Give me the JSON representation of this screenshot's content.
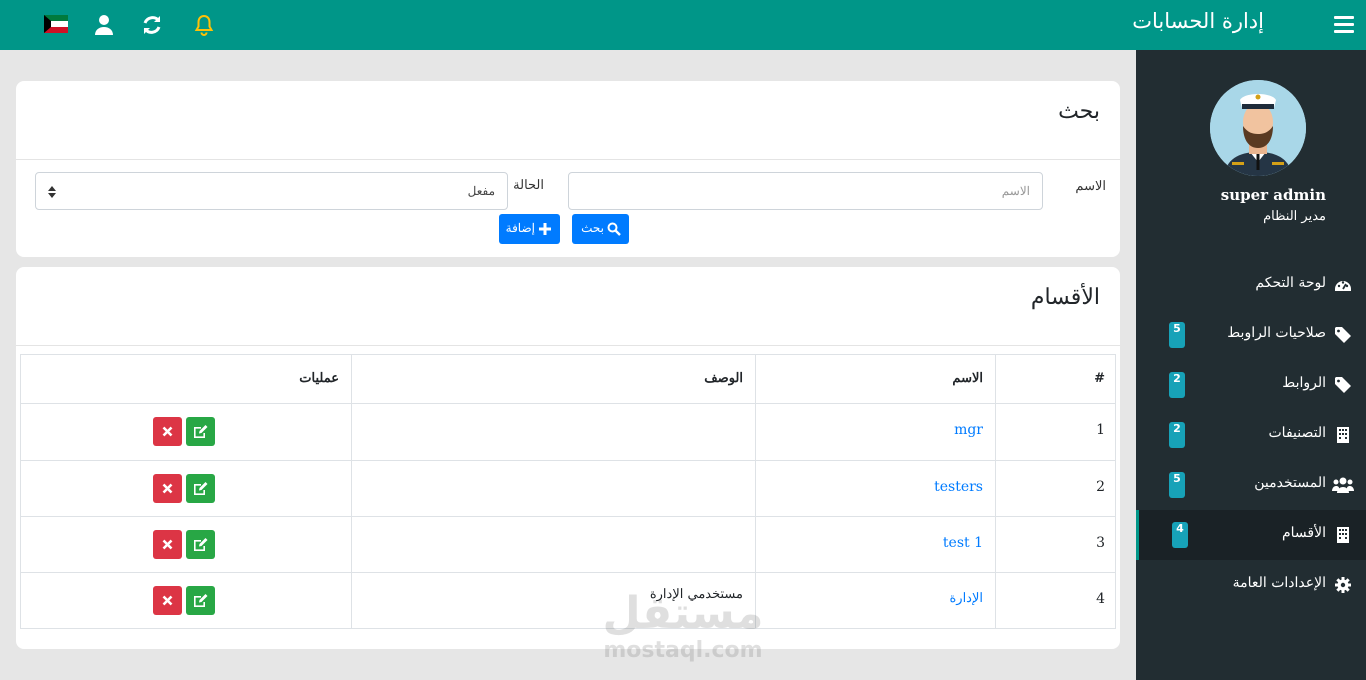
{
  "header": {
    "title": "إدارة الحسابات",
    "accent": "#009688"
  },
  "user": {
    "name": "super admin",
    "role": "مدير النظام"
  },
  "sidebar": {
    "items": [
      {
        "label": "لوحة التحكم",
        "badge": "",
        "icon": "dashboard-icon"
      },
      {
        "label": "صلاحيات الراوبط",
        "badge": "5",
        "icon": "tag-icon"
      },
      {
        "label": "الروابط",
        "badge": "2",
        "icon": "tag-icon"
      },
      {
        "label": "التصنيفات",
        "badge": "2",
        "icon": "building-icon"
      },
      {
        "label": "المستخدمين",
        "badge": "5",
        "icon": "users-icon"
      },
      {
        "label": "الأقسام",
        "badge": "4",
        "icon": "building-icon",
        "active": true
      },
      {
        "label": "الإعدادات العامة",
        "badge": "",
        "icon": "gear-icon"
      }
    ]
  },
  "search": {
    "title": "بحث",
    "name_label": "الاسم",
    "name_placeholder": "الاسم",
    "status_label": "الحالة",
    "status_value": "مفعل",
    "search_button": "بحث",
    "add_button": "إضافة"
  },
  "table": {
    "title": "الأقسام",
    "headers": [
      "#",
      "الاسم",
      "الوصف",
      "عمليات"
    ],
    "rows": [
      {
        "num": "1",
        "name": "mgr",
        "desc": ""
      },
      {
        "num": "2",
        "name": "testers",
        "desc": ""
      },
      {
        "num": "3",
        "name": "test 1",
        "desc": ""
      },
      {
        "num": "4",
        "name": "الإدارة",
        "desc": "مستخدمي الإدارة"
      }
    ]
  },
  "watermark": {
    "arabic": "مستقل",
    "latin": "mostaql.com"
  }
}
